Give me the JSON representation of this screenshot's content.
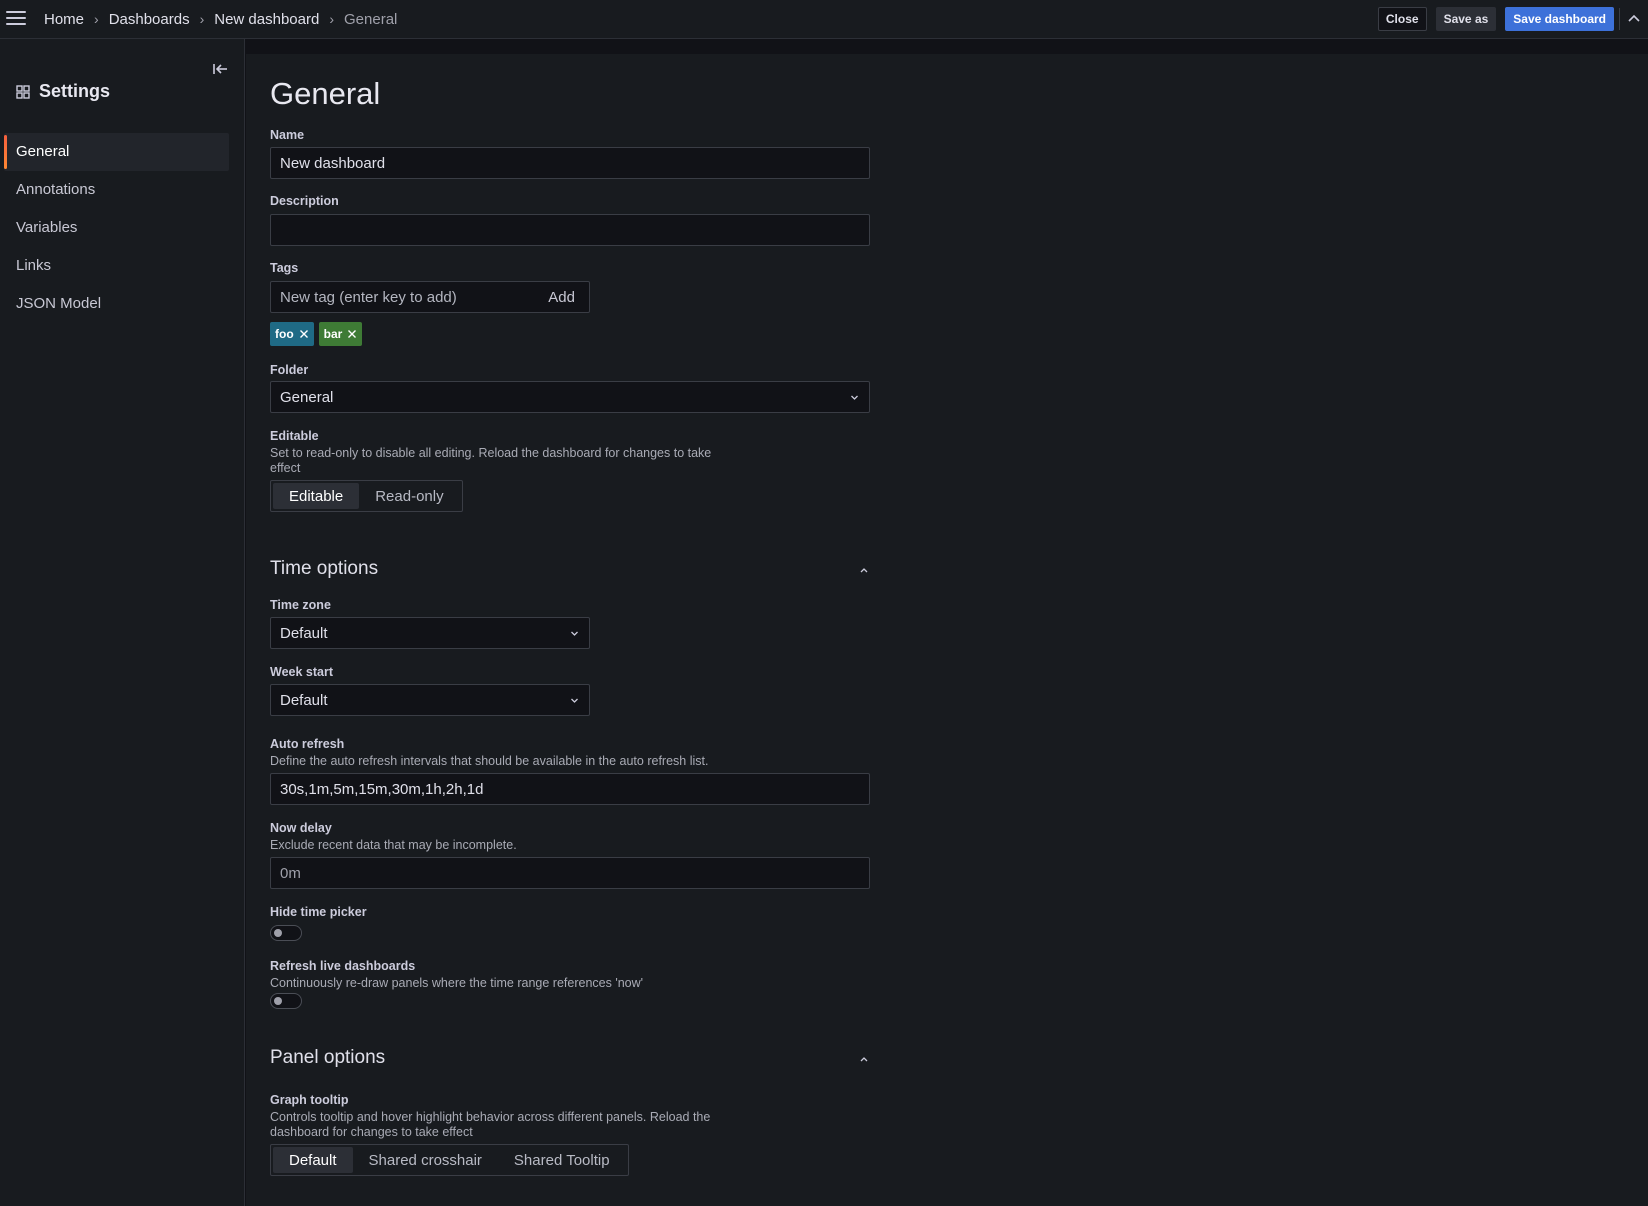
{
  "breadcrumb": {
    "items": [
      "Home",
      "Dashboards",
      "New dashboard"
    ],
    "current": "General"
  },
  "toolbar": {
    "close_label": "Close",
    "save_as_label": "Save as",
    "save_dashboard_label": "Save dashboard"
  },
  "sidebar": {
    "title": "Settings",
    "items": [
      {
        "label": "General",
        "active": true
      },
      {
        "label": "Annotations",
        "active": false
      },
      {
        "label": "Variables",
        "active": false
      },
      {
        "label": "Links",
        "active": false
      },
      {
        "label": "JSON Model",
        "active": false
      }
    ]
  },
  "page": {
    "title": "General",
    "name": {
      "label": "Name",
      "value": "New dashboard"
    },
    "description": {
      "label": "Description",
      "value": ""
    },
    "tags": {
      "label": "Tags",
      "placeholder": "New tag (enter key to add)",
      "add_label": "Add",
      "items": [
        {
          "label": "foo",
          "color": "#1f6a85"
        },
        {
          "label": "bar",
          "color": "#3e7b35"
        }
      ]
    },
    "folder": {
      "label": "Folder",
      "value": "General"
    },
    "editable": {
      "label": "Editable",
      "description": "Set to read-only to disable all editing. Reload the dashboard for changes to take effect",
      "options": [
        "Editable",
        "Read-only"
      ],
      "selected": "Editable"
    }
  },
  "time_options": {
    "title": "Time options",
    "time_zone": {
      "label": "Time zone",
      "value": "Default"
    },
    "week_start": {
      "label": "Week start",
      "value": "Default"
    },
    "auto_refresh": {
      "label": "Auto refresh",
      "description": "Define the auto refresh intervals that should be available in the auto refresh list.",
      "value": "30s,1m,5m,15m,30m,1h,2h,1d"
    },
    "now_delay": {
      "label": "Now delay",
      "description": "Exclude recent data that may be incomplete.",
      "placeholder": "0m"
    },
    "hide_time_picker": {
      "label": "Hide time picker",
      "enabled": false
    },
    "refresh_live": {
      "label": "Refresh live dashboards",
      "description": "Continuously re-draw panels where the time range references 'now'",
      "enabled": false
    }
  },
  "panel_options": {
    "title": "Panel options",
    "graph_tooltip": {
      "label": "Graph tooltip",
      "description": "Controls tooltip and hover highlight behavior across different panels. Reload the dashboard for changes to take effect",
      "options": [
        "Default",
        "Shared crosshair",
        "Shared Tooltip"
      ],
      "selected": "Default"
    }
  },
  "colors": {
    "primary": "#3d71d9",
    "active_accent": "#f55f3e",
    "background": "#111217",
    "panel": "#181b1f"
  }
}
